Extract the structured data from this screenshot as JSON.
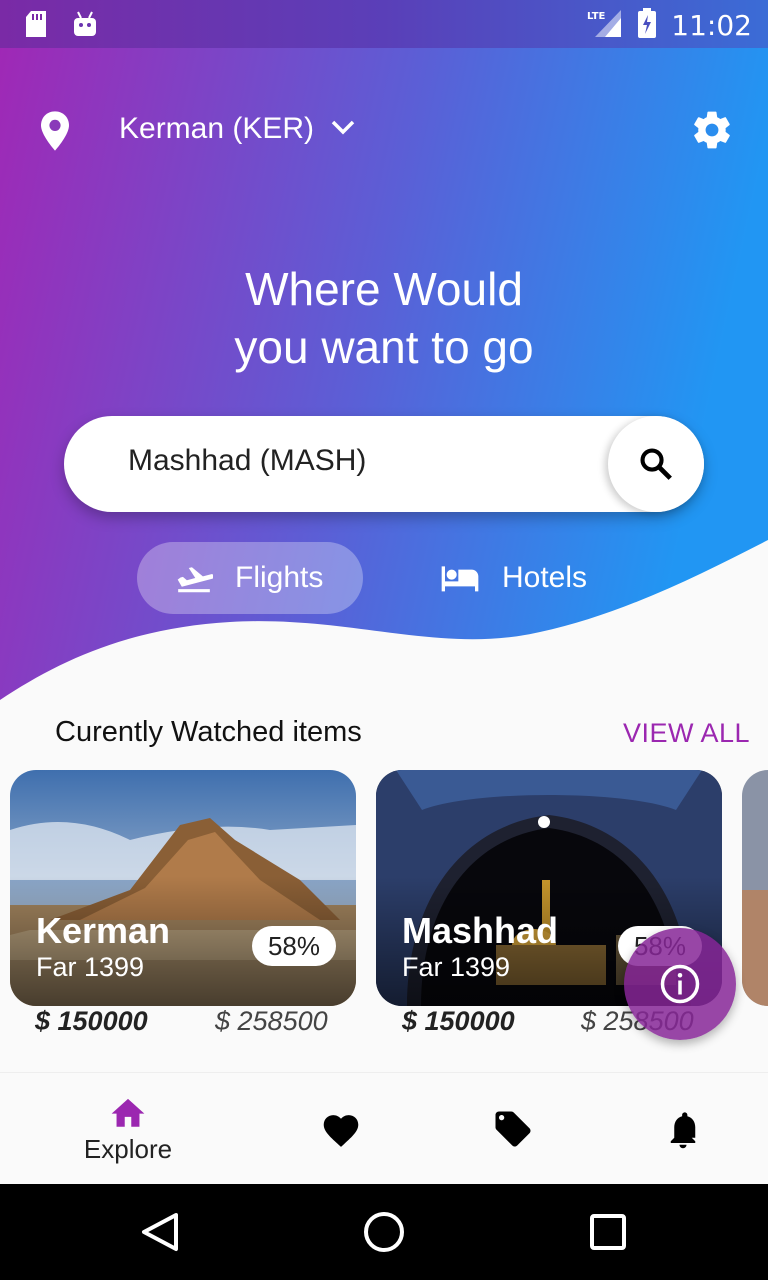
{
  "status_bar": {
    "time": "11:02",
    "network": "LTE"
  },
  "header": {
    "location": "Kerman (KER)",
    "headline_line1": "Where Would",
    "headline_line2": "you want to go"
  },
  "search": {
    "value": "Mashhad (MASH)"
  },
  "tabs": [
    {
      "label": "Flights",
      "active": true
    },
    {
      "label": "Hotels",
      "active": false
    }
  ],
  "section": {
    "title": "Curently Watched items",
    "view_all": "VIEW ALL"
  },
  "cards": [
    {
      "city": "Kerman",
      "date": "Far 1399",
      "discount": "58%",
      "price_new": "$ 150000",
      "price_old": "$ 258500"
    },
    {
      "city": "Mashhad",
      "date": "Far 1399",
      "discount": "58%",
      "price_new": "$ 150000",
      "price_old": "$ 258500"
    }
  ],
  "bottom_nav": [
    {
      "label": "Explore",
      "icon": "home-icon"
    },
    {
      "label": "",
      "icon": "heart-icon"
    },
    {
      "label": "",
      "icon": "tag-icon"
    },
    {
      "label": "",
      "icon": "bell-icon"
    }
  ],
  "colors": {
    "gradient_start": "#9c27b0",
    "gradient_end": "#2196f3",
    "accent": "#9b27b0"
  }
}
